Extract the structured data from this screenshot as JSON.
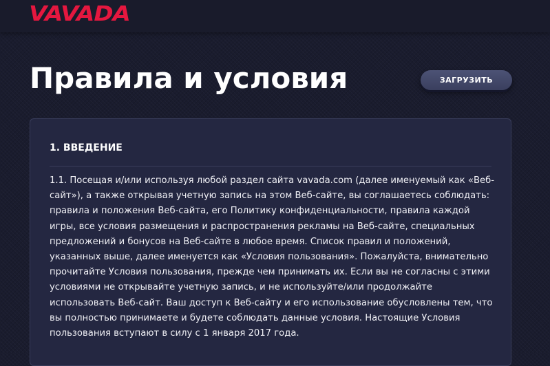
{
  "header": {
    "logo_text": "VAVADA",
    "brand_color": "#e5173f"
  },
  "page": {
    "title": "Правила и условия",
    "download_label": "ЗАГРУЗИТЬ"
  },
  "section": {
    "heading": "1. ВВЕДЕНИЕ",
    "body": "1.1. Посещая и/или используя любой раздел сайта vavada.com (далее именуемый как «Веб-сайт»), а также открывая учетную запись на этом Веб-сайте, вы соглашаетесь соблюдать: правила и положения Веб-сайта, его Политику конфиденциальности, правила каждой игры, все условия размещения и распространения рекламы на Веб-сайте, специальных предложений и бонусов на Веб-сайте в любое время. Список правил и положений, указанных выше, далее именуется как «Условия пользования». Пожалуйста, внимательно прочитайте Условия пользования, прежде чем принимать их. Если вы не согласны с этими условиями не открывайте учетную запись, и не используйте/или продолжайте использовать Веб-сайт. Ваш доступ к Веб-сайту и его использование обусловлены тем, что вы полностью принимаете и будете соблюдать данные условия. Настоящие Условия пользования вступают в силу с 1 января 2017 года."
  }
}
